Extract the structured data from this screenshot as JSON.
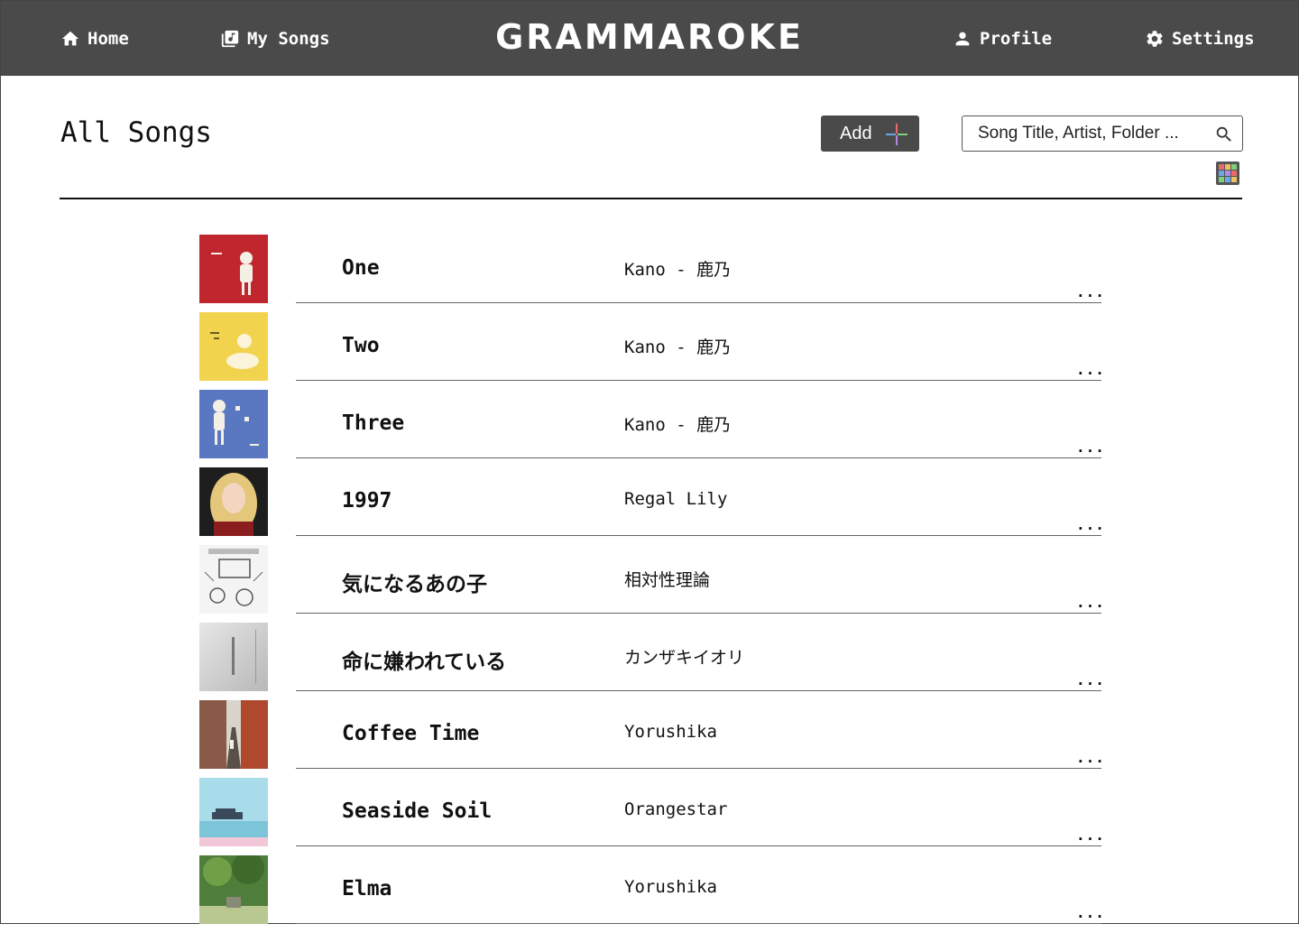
{
  "nav": {
    "home_label": "Home",
    "my_songs_label": "My Songs",
    "brand": "GRAMMAROKE",
    "profile_label": "Profile",
    "settings_label": "Settings"
  },
  "page": {
    "title": "All Songs",
    "add_label": "Add",
    "search_placeholder": "Song Title, Artist, Folder ..."
  },
  "songs": [
    {
      "title": "One",
      "artist": "Kano - 鹿乃",
      "more": "...",
      "cover_color": "#c0262e"
    },
    {
      "title": "Two",
      "artist": "Kano - 鹿乃",
      "more": "...",
      "cover_color": "#f2d34e"
    },
    {
      "title": "Three",
      "artist": "Kano - 鹿乃",
      "more": "...",
      "cover_color": "#5a78c2"
    },
    {
      "title": "1997",
      "artist": "Regal Lily",
      "more": "...",
      "cover_color": "#2a2a2a"
    },
    {
      "title": "気になるあの子",
      "artist": "相対性理論",
      "more": "...",
      "cover_color": "#f2f2f2"
    },
    {
      "title": "命に嫌われている",
      "artist": "カンザキイオリ",
      "more": "...",
      "cover_color": "#c9c9c9"
    },
    {
      "title": "Coffee Time",
      "artist": "Yorushika",
      "more": "...",
      "cover_color": "#7a4a3a"
    },
    {
      "title": "Seaside Soil",
      "artist": "Orangestar",
      "more": "...",
      "cover_color": "#8fd0de"
    },
    {
      "title": "Elma",
      "artist": "Yorushika",
      "more": "...",
      "cover_color": "#4f7d3a"
    }
  ]
}
